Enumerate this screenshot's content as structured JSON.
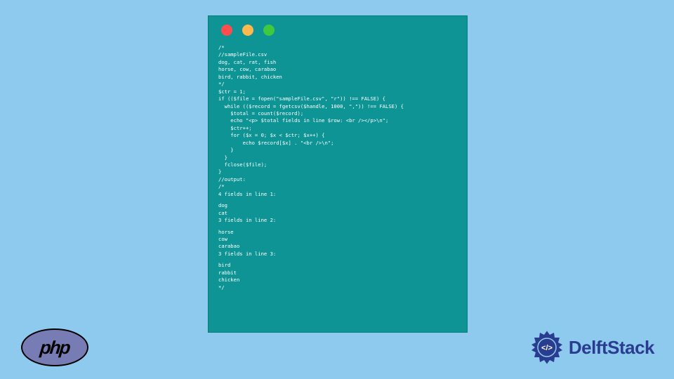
{
  "code_lines": [
    "/*",
    "//sampleFile.csv",
    "dog, cat, rat, fish",
    "horse, cow, carabao",
    "bird, rabbit, chicken",
    "*/",
    "$ctr = 1;",
    "if (($file = fopen(\"sampleFile.csv\", \"r\")) !== FALSE) {",
    "  while (($record = fgetcsv($handle, 1000, \",\")) !== FALSE) {",
    "    $total = count($record);",
    "    echo \"<p> $total fields in line $row: <br /></p>\\n\";",
    "    $ctr++;",
    "    for ($x = 0; $x < $ctr; $x++) {",
    "        echo $record[$x] . \"<br />\\n\";",
    "    }",
    "  }",
    "  fclose($file);",
    "}",
    "//output:",
    "/*",
    "4 fields in line 1:",
    "",
    "dog",
    "cat",
    "3 fields in line 2:",
    "",
    "horse",
    "cow",
    "carabao",
    "3 fields in line 3:",
    "",
    "bird",
    "rabbit",
    "chicken",
    "*/"
  ],
  "php_logo_text": "php",
  "delft_logo_text": "DelftStack",
  "colors": {
    "page_bg": "#8ecaed",
    "window_bg": "#0e9494",
    "php_bg": "#787cb5",
    "delft_text": "#2a3c8f"
  }
}
